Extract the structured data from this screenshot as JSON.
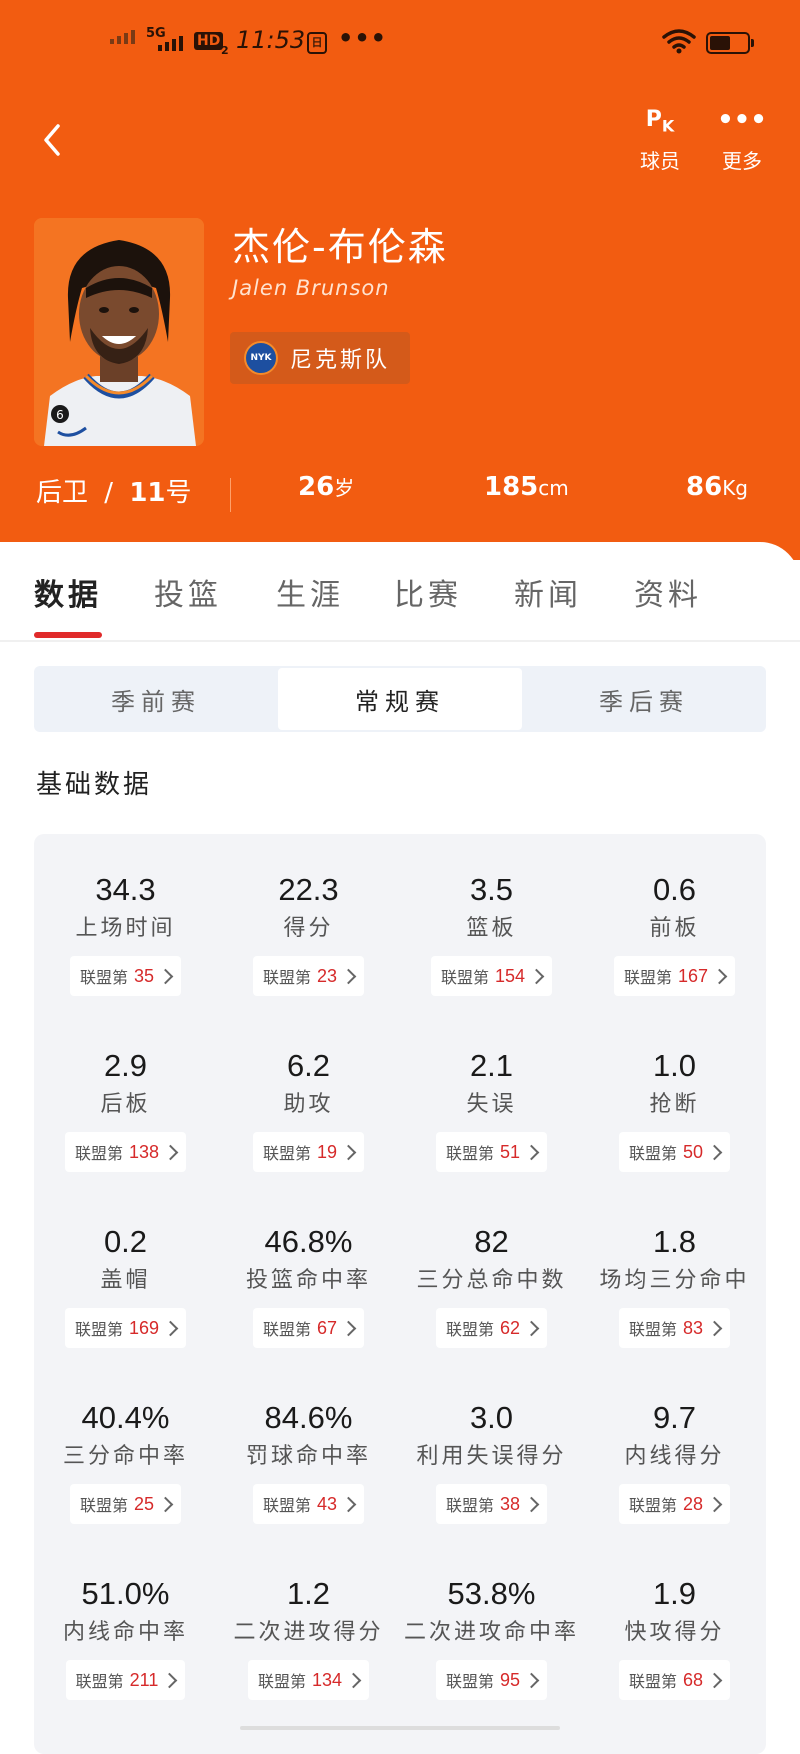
{
  "status_bar": {
    "network": "5G",
    "hd": "HD",
    "hd_sub": "2",
    "time": "11:53",
    "notif_glyph": "日",
    "dots": "•••",
    "battery_level": 0.55
  },
  "nav": {
    "pk_glyph_main": "P",
    "pk_glyph_sub": "K",
    "pk_label": "球员",
    "more_glyph": "•••",
    "more_label": "更多"
  },
  "player": {
    "name_cn": "杰伦-布伦森",
    "name_en": "Jalen Brunson",
    "team": "尼克斯队",
    "team_logo_text": "NYK",
    "position": "后卫",
    "separator": "/",
    "number": "11",
    "number_unit": "号",
    "age": "26",
    "age_unit": "岁",
    "height": "185",
    "height_unit": "cm",
    "weight": "86",
    "weight_unit": "Kg",
    "jersey_number": "6"
  },
  "tabs": [
    "数据",
    "投篮",
    "生涯",
    "比赛",
    "新闻",
    "资料"
  ],
  "season_tabs": [
    "季前赛",
    "常规赛",
    "季后赛"
  ],
  "section_title": "基础数据",
  "rank_prefix": "联盟第",
  "stats": [
    {
      "value": "34.3",
      "label": "上场时间",
      "rank": "35"
    },
    {
      "value": "22.3",
      "label": "得分",
      "rank": "23"
    },
    {
      "value": "3.5",
      "label": "篮板",
      "rank": "154"
    },
    {
      "value": "0.6",
      "label": "前板",
      "rank": "167"
    },
    {
      "value": "2.9",
      "label": "后板",
      "rank": "138"
    },
    {
      "value": "6.2",
      "label": "助攻",
      "rank": "19"
    },
    {
      "value": "2.1",
      "label": "失误",
      "rank": "51"
    },
    {
      "value": "1.0",
      "label": "抢断",
      "rank": "50"
    },
    {
      "value": "0.2",
      "label": "盖帽",
      "rank": "169"
    },
    {
      "value": "46.8%",
      "label": "投篮命中率",
      "rank": "67"
    },
    {
      "value": "82",
      "label": "三分总命中数",
      "rank": "62"
    },
    {
      "value": "1.8",
      "label": "场均三分命中",
      "rank": "83"
    },
    {
      "value": "40.4%",
      "label": "三分命中率",
      "rank": "25"
    },
    {
      "value": "84.6%",
      "label": "罚球命中率",
      "rank": "43"
    },
    {
      "value": "3.0",
      "label": "利用失误得分",
      "rank": "38"
    },
    {
      "value": "9.7",
      "label": "内线得分",
      "rank": "28"
    },
    {
      "value": "51.0%",
      "label": "内线命中率",
      "rank": "211"
    },
    {
      "value": "1.2",
      "label": "二次进攻得分",
      "rank": "134"
    },
    {
      "value": "53.8%",
      "label": "二次进攻命中率",
      "rank": "95"
    },
    {
      "value": "1.9",
      "label": "快攻得分",
      "rank": "68"
    }
  ],
  "colors": {
    "header": "#f25c11",
    "accent_red": "#e02a2a",
    "rank_red": "#d62a2a",
    "card_bg": "#f3f4f7"
  }
}
